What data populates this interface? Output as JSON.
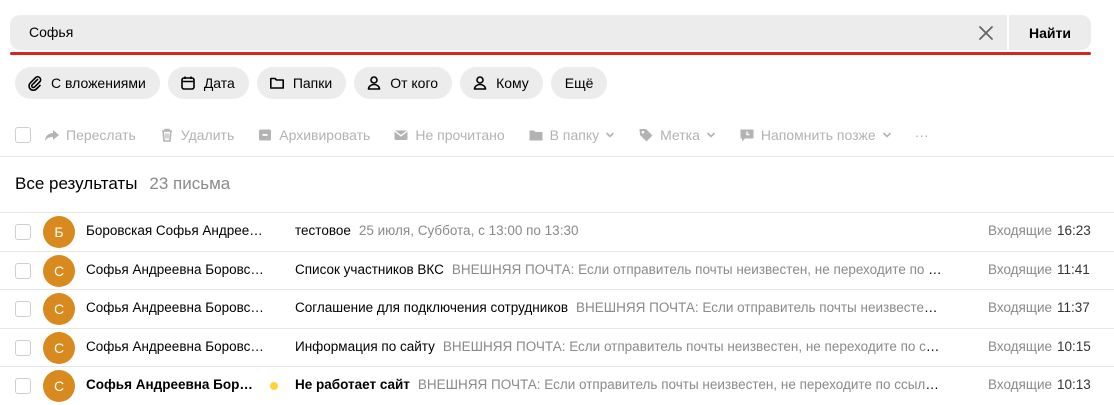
{
  "search": {
    "value": "Софья",
    "button_label": "Найти"
  },
  "filters": [
    {
      "label": "С вложениями",
      "icon": "paperclip-icon"
    },
    {
      "label": "Дата",
      "icon": "calendar-icon"
    },
    {
      "label": "Папки",
      "icon": "folder-icon"
    },
    {
      "label": "От кого",
      "icon": "person-icon"
    },
    {
      "label": "Кому",
      "icon": "person-icon"
    },
    {
      "label": "Ещё",
      "icon": ""
    }
  ],
  "toolbar": {
    "forward": "Переслать",
    "delete": "Удалить",
    "archive": "Архивировать",
    "unread": "Не прочитано",
    "to_folder": "В папку",
    "label": "Метка",
    "remind": "Напомнить позже",
    "more": "···"
  },
  "results": {
    "title": "Все результаты",
    "count": "23 письма"
  },
  "messages": [
    {
      "avatar": "Б",
      "sender": "Боровская Софья Андреевна",
      "subject": "тестовое",
      "snippet": "25 июля, Суббота, с 13:00 по 13:30",
      "folder": "Входящие",
      "time": "16:23",
      "unread": false
    },
    {
      "avatar": "С",
      "sender": "Софья Андреевна Боровская",
      "subject": "Список участников ВКС",
      "snippet": "ВНЕШНЯЯ ПОЧТА: Если отправитель почты неизвестен, не переходите по ссылкам",
      "folder": "Входящие",
      "time": "11:41",
      "unread": false
    },
    {
      "avatar": "С",
      "sender": "Софья Андреевна Боровская",
      "subject": "Соглашение для подключения сотрудников",
      "snippet": "ВНЕШНЯЯ ПОЧТА: Если отправитель почты неизвестен, не переходите",
      "folder": "Входящие",
      "time": "11:37",
      "unread": false
    },
    {
      "avatar": "С",
      "sender": "Софья Андреевна Боровская",
      "subject": "Информация по сайту",
      "snippet": "ВНЕШНЯЯ ПОЧТА: Если отправитель почты неизвестен, не переходите по ссылкам",
      "folder": "Входящие",
      "time": "10:15",
      "unread": false
    },
    {
      "avatar": "С",
      "sender": "Софья Андреевна Боровская",
      "subject": "Не работает сайт",
      "snippet": "ВНЕШНЯЯ ПОЧТА: Если отправитель почты неизвестен, не переходите по ссылкам, не открывайте",
      "folder": "Входящие",
      "time": "10:13",
      "unread": true
    }
  ]
}
